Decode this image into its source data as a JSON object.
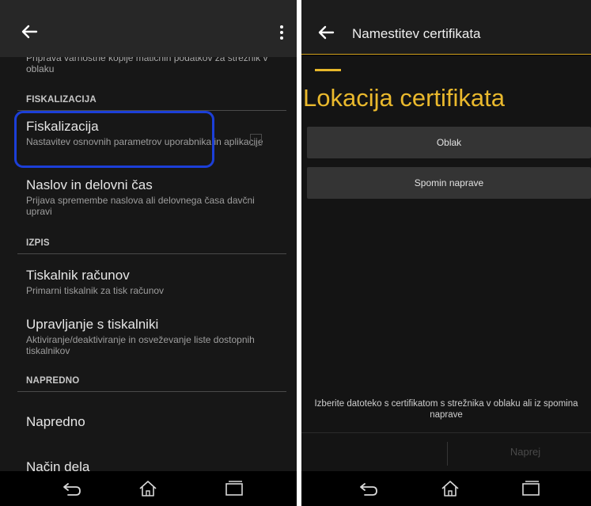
{
  "left_screen": {
    "partial_item_summary": "Priprava varnostne kopije matičnih podatkov za strežnik v oblaku",
    "sections": {
      "fiskalizacija": "FISKALIZACIJA",
      "izpis": "IZPIS",
      "napredno": "NAPREDNO"
    },
    "items": {
      "fiskalizacija": {
        "title": "Fiskalizacija",
        "summary": "Nastavitev osnovnih parametrov uporabnika in aplikacije"
      },
      "naslov": {
        "title": "Naslov in delovni čas",
        "summary": "Prijava spremembe naslova ali delovnega časa davčni upravi"
      },
      "tiskalnik": {
        "title": "Tiskalnik računov",
        "summary": "Primarni tiskalnik za tisk računov"
      },
      "upravljanje": {
        "title": "Upravljanje s tiskalniki",
        "summary": "Aktiviranje/deaktiviranje in osveževanje liste dostopnih tiskalnikov"
      },
      "napredno": {
        "title": "Napredno"
      },
      "nacin": {
        "title": "Način dela"
      }
    },
    "highlight_color": "#1c3fd8"
  },
  "right_screen": {
    "title": "Namestitev certifikata",
    "heading": "Lokacija certifikata",
    "option_cloud": "Oblak",
    "option_device": "Spomin naprave",
    "instruction": "Izberite datoteko s certifikatom s strežnika v oblaku ali iz spomina naprave",
    "next_label": "Naprej",
    "accent_color": "#eab92d"
  },
  "icons": {
    "back": "arrow-left",
    "overflow": "three-dots-vertical",
    "nav_back": "back",
    "nav_home": "home",
    "nav_recents": "recents"
  }
}
